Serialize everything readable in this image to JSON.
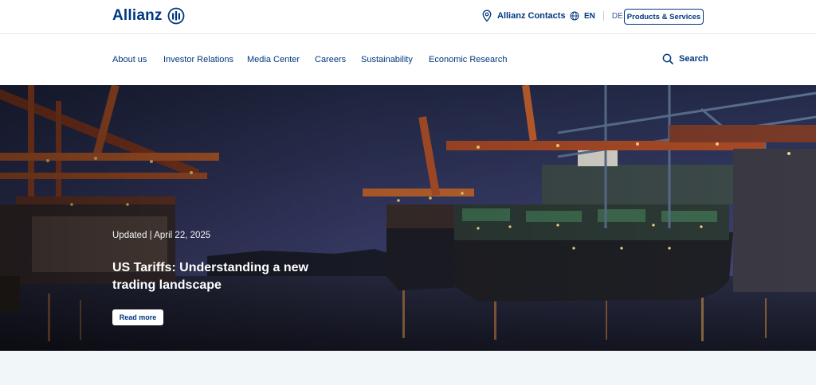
{
  "header": {
    "logo_text": "Allianz",
    "contacts_label": "Allianz Contacts",
    "lang_active": "EN",
    "lang_other": "DE",
    "products_button": "Products & Services"
  },
  "nav": {
    "items": [
      "About us",
      "Investor Relations",
      "Media Center",
      "Careers",
      "Sustainability",
      "Economic Research"
    ],
    "search_label": "Search"
  },
  "hero": {
    "updated": "Updated | April 22, 2025",
    "headline": "US Tariffs: Understanding a new trading landscape",
    "cta": "Read more"
  },
  "icons": [
    "allianz-logo-icon",
    "location-pin-icon",
    "globe-icon",
    "search-icon"
  ],
  "colors": {
    "brand": "#003781",
    "below_bg": "#f1f6f9"
  }
}
